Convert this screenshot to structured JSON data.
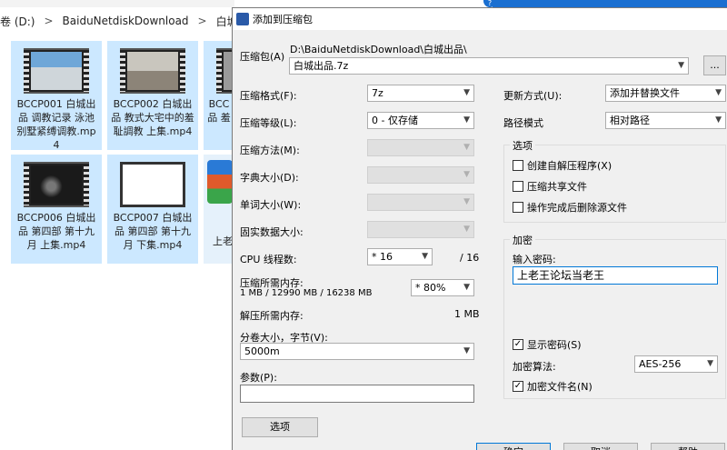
{
  "explorer": {
    "breadcrumb": [
      "卷 (D:)",
      ">",
      "BaiduNetdiskDownload",
      ">",
      "白城出品"
    ],
    "tiles": [
      {
        "label": "BCCP001 白城出品 调教记录 泳池别墅紧缚调教.mp4"
      },
      {
        "label": "BCCP002 白城出品 ‌教式大宅中的羞耻調教 上集.mp4"
      },
      {
        "label": "BCC 品 羞"
      },
      {
        "label": "BCCP006 白城出品 第四部 第十九月 上集.mp4"
      },
      {
        "label": "BCCP007 白城出品 第四部 第十九月 下集.mp4"
      },
      {
        "label": "上老"
      }
    ]
  },
  "dialog": {
    "title": "添加到压缩包",
    "archive_label": "压缩包(A)",
    "archive_path": "D:\\BaiduNetdiskDownload\\白城出品\\",
    "archive_name": "白城出品.7z",
    "browse": "...",
    "format_label": "压缩格式(F):",
    "format_value": "7z",
    "level_label": "压缩等级(L):",
    "level_value": "0 - 仅存储",
    "method_label": "压缩方法(M):",
    "dict_label": "字典大小(D):",
    "word_label": "单词大小(W):",
    "solid_label": "固实数据大小:",
    "threads_label": "CPU 线程数:",
    "threads_value": "* 16",
    "threads_total": "/ 16",
    "mem_label": "压缩所需内存:",
    "mem_detail": "1 MB / 12990 MB / 16238 MB",
    "mem_value": "* 80%",
    "decomp_label": "解压所需内存:",
    "decomp_value": "1 MB",
    "volume_label": "分卷大小，字节(V):",
    "volume_value": "5000m",
    "params_label": "参数(P):",
    "params_value": "",
    "options_button": "选项",
    "update_label": "更新方式(U):",
    "update_value": "添加并替换文件",
    "path_label": "路径模式",
    "path_value": "相对路径",
    "options_group": "选项",
    "opt_sfx": "创建自解压程序(X)",
    "opt_shared": "压缩共享文件",
    "opt_delete": "操作完成后删除源文件",
    "encrypt_group": "加密",
    "password_label": "输入密码:",
    "password_value": "上老王论坛当老王",
    "show_password": "显示密码(S)",
    "enc_method_label": "加密算法:",
    "enc_method_value": "AES-256",
    "encrypt_names": "加密文件名(N)",
    "ok": "确定",
    "cancel": "取消",
    "help": "帮助"
  },
  "colors": {
    "selection": "#cce8ff",
    "dialog_bg": "#f0f0f0",
    "accent": "#1a6fd1"
  }
}
